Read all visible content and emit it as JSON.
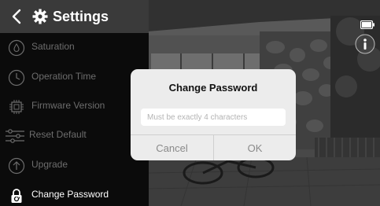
{
  "header": {
    "title": "Settings",
    "back_icon": "chevron-left-icon",
    "settings_icon": "gear-icon"
  },
  "sidebar": {
    "items": [
      {
        "label": "Saturation",
        "icon": "saturation-icon",
        "active": false
      },
      {
        "label": "Operation Time",
        "icon": "clock-icon",
        "active": false
      },
      {
        "label": "Firmware Version",
        "icon": "chip-icon",
        "active": false
      },
      {
        "label": "Reset Default",
        "icon": "sliders-icon",
        "active": false
      },
      {
        "label": "Upgrade",
        "icon": "upload-icon",
        "active": false
      },
      {
        "label": "Change Password",
        "icon": "lock-icon",
        "active": true
      }
    ]
  },
  "status": {
    "battery_icon": "battery-icon",
    "info_icon": "info-icon"
  },
  "dialog": {
    "title": "Change Password",
    "input_placeholder": "Must be exactly 4 characters",
    "input_value": "",
    "cancel_label": "Cancel",
    "ok_label": "OK"
  },
  "colors": {
    "header_bg": "#3a3a3a",
    "sidebar_bg": "#0b0b0b",
    "inactive_text": "#6d6d6d",
    "active_text": "#ffffff",
    "dialog_bg": "#ececec",
    "dialog_button_text": "#8a8a8a"
  }
}
